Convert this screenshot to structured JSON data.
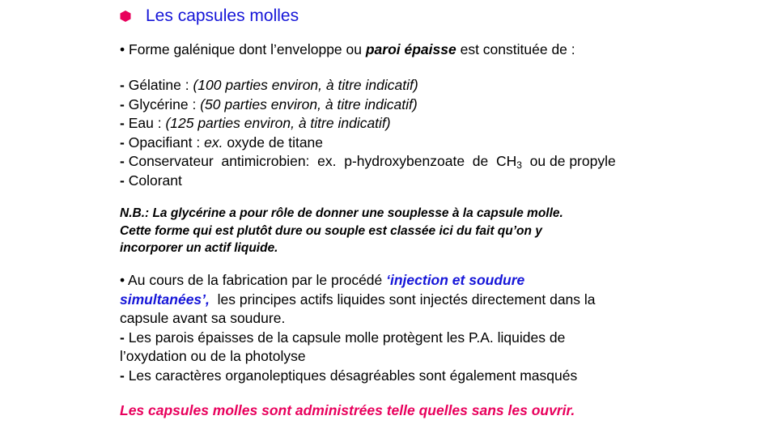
{
  "title": "Les capsules molles",
  "colors": {
    "title": "#1515d8",
    "bullet": "#e8005c",
    "highlight_blue": "#1515d8",
    "conclusion": "#e8005c"
  },
  "intro": {
    "bullet": "•",
    "pre": "Forme galénique  dont  l’enveloppe  ou ",
    "emph": "paroi épaisse",
    "post": " est constituée de :"
  },
  "components": [
    {
      "dash": "-",
      "name": "Gélatine : ",
      "detail": "(100 parties environ, à titre indicatif)"
    },
    {
      "dash": "-",
      "name": "Glycérine : ",
      "detail": "(50 parties environ, à titre indicatif)"
    },
    {
      "dash": "-",
      "name": "Eau : ",
      "detail": "(125 parties environ, à titre indicatif)"
    },
    {
      "dash": "-",
      "name": "Opacifiant : ",
      "detail_i": "ex.",
      "detail_rest": " oxyde de titane"
    },
    {
      "dash": "-",
      "name": "Conservateur  antimicrobien:  ex.  p-hydroxybenzoate  de  CH",
      "sub": "3",
      "tail": "  ou de propyle"
    },
    {
      "dash": "-",
      "name": "Colorant"
    }
  ],
  "nb": {
    "line1": "N.B.: La glycérine a pour rôle de donner une souplesse à la capsule molle.",
    "line2": "Cette forme qui est plutôt dure ou souple est classée ici du fait qu’on y",
    "line3": "incorporer un actif liquide."
  },
  "fabrication": {
    "bullet": "•",
    "l1_pre": "Au cours de la fabrication par le procédé ",
    "l1_blue": "‘injection et soudure",
    "l2_blue": "simultanées’,",
    "l2_post": "  les principes actifs liquides sont injectés directement dans la",
    "l3": "capsule avant sa soudure.",
    "l4_dash": "-",
    "l4": "Les parois épaisses de la capsule molle protègent les P.A. liquides de",
    "l5": "l’oxydation ou de la photolyse",
    "l6_dash": "-",
    "l6": "Les caractères organoleptiques désagréables sont également masqués"
  },
  "conclusion": "Les capsules molles sont administrées telle quelles sans les ouvrir."
}
